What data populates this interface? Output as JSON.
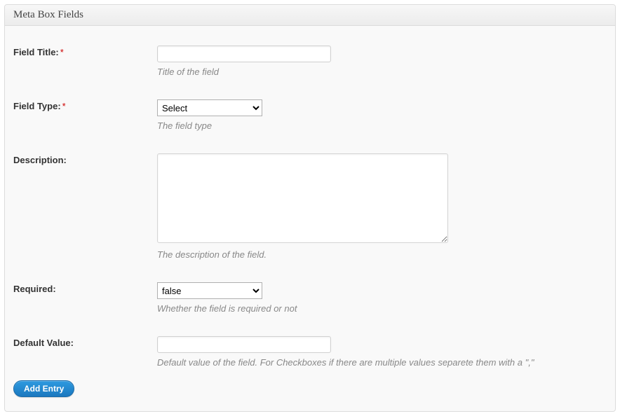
{
  "panel": {
    "title": "Meta Box Fields"
  },
  "fields": {
    "field_title": {
      "label": "Field Title:",
      "required": true,
      "value": "",
      "help": "Title of the field"
    },
    "field_type": {
      "label": "Field Type:",
      "required": true,
      "selected": "Select",
      "help": "The field type"
    },
    "description": {
      "label": "Description:",
      "value": "",
      "help": "The description of the field."
    },
    "required": {
      "label": "Required:",
      "selected": "false",
      "help": "Whether the field is required or not"
    },
    "default_value": {
      "label": "Default Value:",
      "value": "",
      "help": "Default value of the field. For Checkboxes if there are multiple values separete them with a \",\""
    }
  },
  "buttons": {
    "add_entry": "Add Entry"
  }
}
